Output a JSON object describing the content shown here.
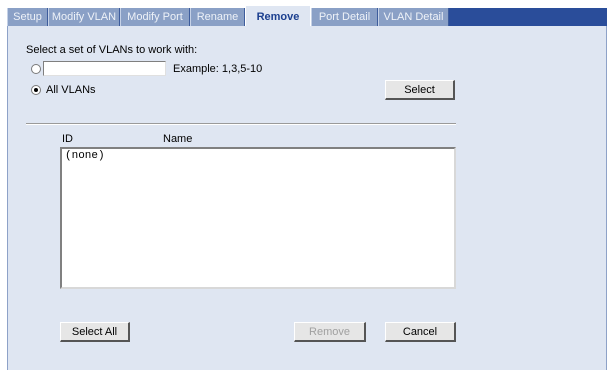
{
  "tabs": [
    {
      "label": "Setup",
      "active": false
    },
    {
      "label": "Modify VLAN",
      "active": false
    },
    {
      "label": "Modify Port",
      "active": false
    },
    {
      "label": "Rename",
      "active": false
    },
    {
      "label": "Remove",
      "active": true
    },
    {
      "label": "Port Detail",
      "active": false
    },
    {
      "label": "VLAN Detail",
      "active": false
    }
  ],
  "selection": {
    "prompt": "Select a set of VLANs to work with:",
    "custom_value": "",
    "example": "Example: 1,3,5-10",
    "all_label": "All VLANs",
    "selected_option": "All VLANs",
    "select_button": "Select"
  },
  "list": {
    "col_id": "ID",
    "col_name": "Name",
    "items": [
      "(none)"
    ]
  },
  "buttons": {
    "select_all": "Select All",
    "remove": "Remove",
    "remove_enabled": false,
    "cancel": "Cancel"
  },
  "colors": {
    "tab_bar": "#2a4d9a",
    "tab_inactive": "#8aa0c6",
    "panel": "#dfe6f2",
    "active_tab_text": "#1b3f8f"
  }
}
